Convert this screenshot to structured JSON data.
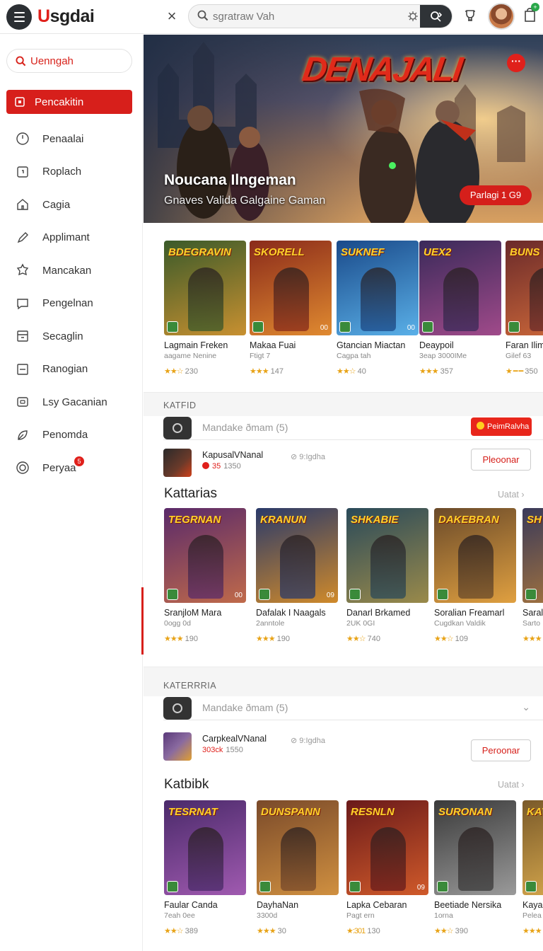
{
  "app": {
    "title": "Usgdai",
    "title_accent": "U",
    "title_rest": "sgdai"
  },
  "search": {
    "placeholder": "sgratraw Vah",
    "close": "×"
  },
  "cart": {
    "badge": "+"
  },
  "sidebar": {
    "search_label": "Uenngah",
    "items": [
      {
        "label": "Pencakitin",
        "icon": "square-icon",
        "active": true
      },
      {
        "label": "Penaalai",
        "icon": "clock-icon"
      },
      {
        "label": "Roplach",
        "icon": "box-icon"
      },
      {
        "label": "Cagia",
        "icon": "home-icon"
      },
      {
        "label": "Applimant",
        "icon": "pen-icon"
      },
      {
        "label": "Mancakan",
        "icon": "puzzle-icon"
      },
      {
        "label": "Pengelnan",
        "icon": "chat-icon"
      },
      {
        "label": "Secaglin",
        "icon": "calendar-icon"
      },
      {
        "label": "Ranogian",
        "icon": "minus-box-icon"
      },
      {
        "label": "Lsy Gacanian",
        "icon": "device-icon"
      },
      {
        "label": "Penomda",
        "icon": "leaf-icon"
      },
      {
        "label": "Peryaa",
        "icon": "target-icon",
        "badge": "5"
      }
    ]
  },
  "hero": {
    "logo_text": "DENAJALI",
    "title": "Noucana Ilngeman",
    "subtitle": "Gnaves Valida Galgaine Gaman",
    "button": "Parlagi 1 G9",
    "menu": "···"
  },
  "row1": [
    {
      "cover": "BDEGRAVIN",
      "title": "Lagmain Freken",
      "sub": "aagame Nenine",
      "stars": "★★☆",
      "count": "230",
      "colors": [
        "#3a5a2a",
        "#c89030"
      ],
      "num": ""
    },
    {
      "cover": "SKORELL",
      "title": "Makaa Fuai",
      "sub": "Ftigt 7",
      "stars": "★★★",
      "count": "147",
      "colors": [
        "#8a2a1a",
        "#e08a30"
      ],
      "num": "00"
    },
    {
      "cover": "SUKNEF",
      "title": "Gtancian Miactan",
      "sub": "Cagpa tah",
      "stars": "★★☆",
      "count": "40",
      "colors": [
        "#1a4a8a",
        "#5ab0e8"
      ],
      "num": "00"
    },
    {
      "cover": "UEX2",
      "title": "Deaypoil",
      "sub": "3eap 3000IMe",
      "stars": "★★★",
      "count": "357",
      "colors": [
        "#3a2a5a",
        "#a04a8a"
      ],
      "num": ""
    },
    {
      "cover": "BUNS",
      "title": "Faran Ilim",
      "sub": "Gilef 63",
      "stars": "★ ━ ━",
      "count": "350",
      "colors": [
        "#6a2a2a",
        "#d06a3a"
      ],
      "num": ""
    }
  ],
  "section1": {
    "head": "KATFID",
    "placeholder": "Mandake ðmam (5)",
    "pill": "PeimRalvha",
    "promo": {
      "name": "KapusalVNanal",
      "meta": "35",
      "meta2": "1350",
      "extra": "9:Igdha",
      "button": "Pleoonar"
    }
  },
  "row2_title": "Kattarias",
  "row2_more": "Uatat",
  "row2": [
    {
      "cover": "TEGRNAN",
      "title": "SranjloM Mara",
      "sub": "0ogg 0d",
      "stars": "★★★",
      "count": "190",
      "colors": [
        "#5a2a6a",
        "#c06a4a"
      ],
      "num": "00"
    },
    {
      "cover": "KRANUN",
      "title": "Dafalak I Naagals",
      "sub": "2anntole",
      "stars": "★★★",
      "count": "190",
      "colors": [
        "#2a3a6a",
        "#d08a2a"
      ],
      "num": "09"
    },
    {
      "cover": "SHKABIE",
      "title": "Danarl Brkamed",
      "sub": "2UK 0GI",
      "stars": "★★☆",
      "count": "740",
      "colors": [
        "#2a4a5a",
        "#9a8a4a"
      ],
      "num": ""
    },
    {
      "cover": "DAKEBRAN",
      "title": "Soralian Freamarl",
      "sub": "Cugdkan Valdik",
      "stars": "★★☆",
      "count": "109",
      "colors": [
        "#6a4a2a",
        "#e0a040"
      ],
      "num": ""
    },
    {
      "cover": "SH",
      "title": "Saral",
      "sub": "Sarto",
      "stars": "★★★",
      "count": "",
      "colors": [
        "#3a3a5a",
        "#b07a3a"
      ],
      "num": ""
    }
  ],
  "section2": {
    "head": "KATERRRIA",
    "placeholder": "Mandake ðmam (5)",
    "chev": "⌄",
    "promo": {
      "name": "CarpkealVNanal",
      "meta": "303ck",
      "meta2": "1550",
      "extra": "9:Igdha",
      "button": "Peroonar"
    }
  },
  "row3_title": "Katbibk",
  "row3_more": "Uatat",
  "row3": [
    {
      "cover": "TESRNAT",
      "title": "Faular Canda",
      "sub": "7eah 0ee",
      "stars": "★★☆",
      "count": "389",
      "colors": [
        "#4a2a6a",
        "#a05ab0"
      ],
      "num": ""
    },
    {
      "cover": "DUNSPANN",
      "title": "DayhaNan",
      "sub": "3300d",
      "stars": "★★★",
      "count": "30",
      "colors": [
        "#7a4a2a",
        "#d09040"
      ],
      "num": ""
    },
    {
      "cover": "RESNLN",
      "title": "Lapka Cebaran",
      "sub": "Pagt ern",
      "stars": "★:301",
      "count": "130",
      "colors": [
        "#6a1a1a",
        "#d05a2a"
      ],
      "num": "09"
    },
    {
      "cover": "SURONAN",
      "title": "Beetiade Nersika",
      "sub": "1orna",
      "stars": "★★☆",
      "count": "390",
      "colors": [
        "#3a3a3a",
        "#9a9a9a"
      ],
      "num": ""
    },
    {
      "cover": "KAY",
      "title": "Kaya",
      "sub": "Pelea",
      "stars": "★★★",
      "count": "",
      "colors": [
        "#7a5a2a",
        "#e0b050"
      ],
      "num": ""
    }
  ]
}
